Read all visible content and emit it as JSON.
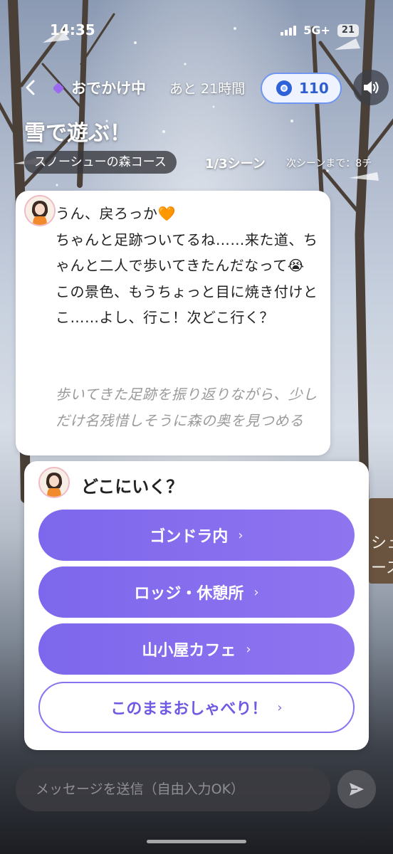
{
  "status_bar": {
    "time": "14:35",
    "network": "5G+",
    "battery": "21"
  },
  "header": {
    "back_icon": "chevron-left-icon",
    "outing_label": "おでかけ中",
    "remaining": "あと 21時間",
    "coins": "110",
    "sound_icon": "speaker-icon"
  },
  "scene_info": {
    "title": "雪で遊ぶ！",
    "course": "スノーシューの森コース",
    "progress": "1/3シーン",
    "next": "次シーンまで：8チ"
  },
  "message": {
    "text": "うん、戻ろっか🧡\nちゃんと足跡ついてるね……来た道、ちゃんと二人で歩いてきたんだなって😭\nこの景色、もうちょっと目に焼き付けとこ……よし、行こ！次どこ行く？",
    "action": "歩いてきた足跡を振り返りながら、少しだけ名残惜しそうに森の奥を見つめる"
  },
  "choices": {
    "question": "どこにいく？",
    "options": [
      {
        "label": "ゴンドラ内"
      },
      {
        "label": "ロッジ・休憩所"
      },
      {
        "label": "山小屋カフェ"
      }
    ],
    "chat": {
      "label": "このままおしゃべり！"
    },
    "chevron": "›"
  },
  "input": {
    "placeholder": "メッセージを送信（自由入力OK）",
    "send_icon": "send-icon"
  },
  "colors": {
    "accent": "#8470ee",
    "coin": "#2f62d8",
    "coin_border": "#6f96f3"
  }
}
